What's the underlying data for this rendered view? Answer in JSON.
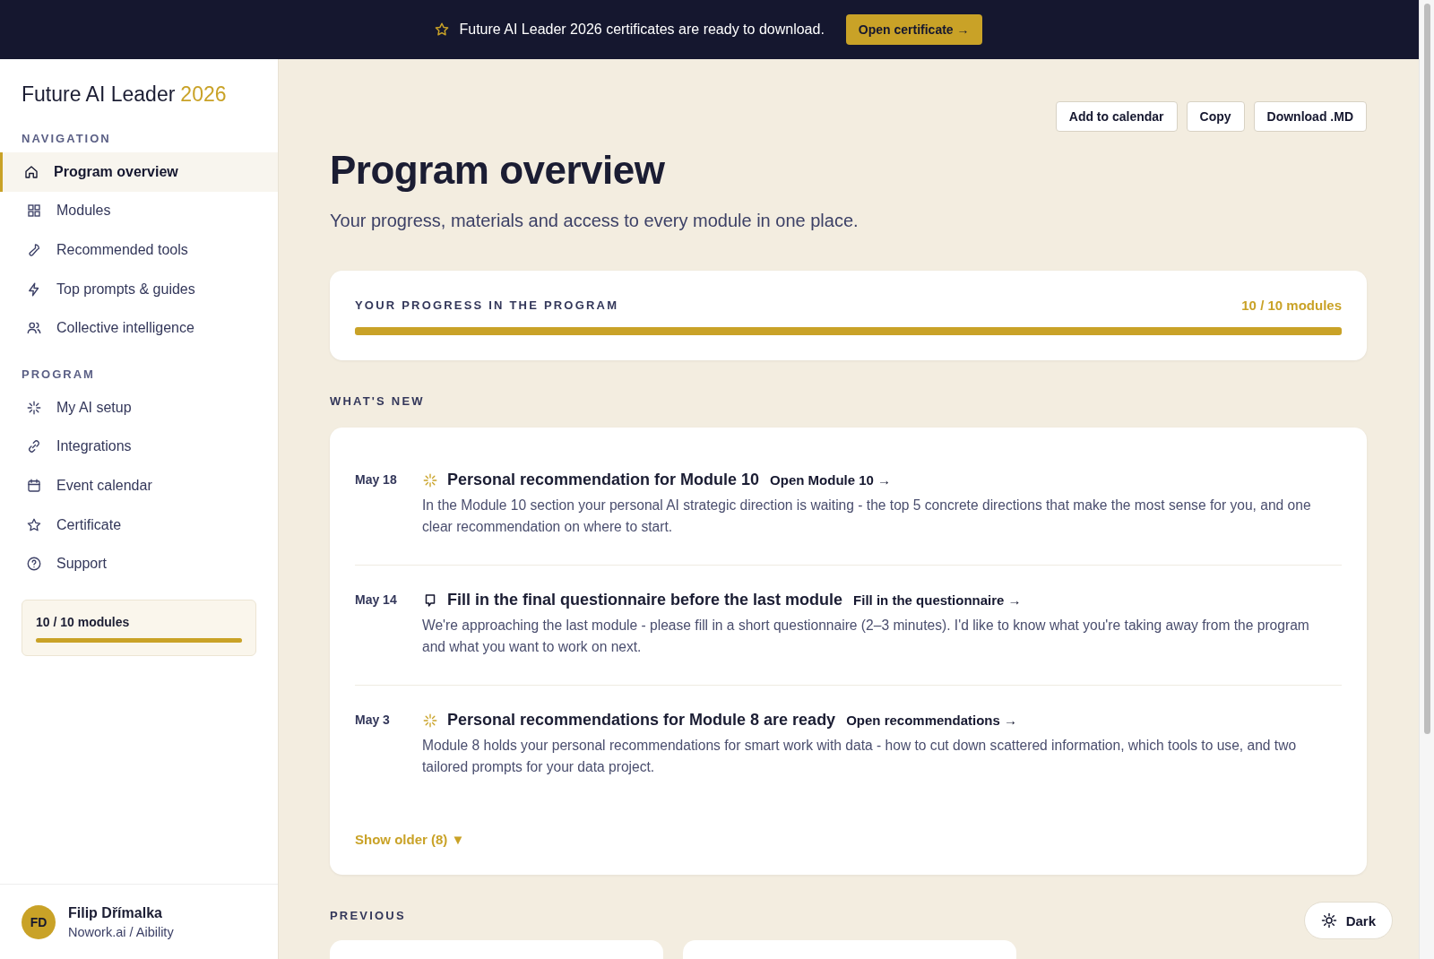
{
  "banner": {
    "text": "Future AI Leader 2026 certificates are ready to download.",
    "button": "Open certificate →"
  },
  "sidebar": {
    "brand": "Future AI Leader",
    "brand_year": "2026",
    "sections": [
      {
        "title": "NAVIGATION",
        "items": [
          {
            "label": "Program overview",
            "kind": "home",
            "selected": true
          },
          {
            "label": "Modules",
            "kind": "grid",
            "selected": false
          },
          {
            "label": "Recommended tools",
            "kind": "wrench",
            "selected": false
          },
          {
            "label": "Top prompts & guides",
            "kind": "bolt",
            "selected": false
          },
          {
            "label": "Collective intelligence",
            "kind": "users",
            "selected": false
          }
        ]
      },
      {
        "title": "PROGRAM",
        "items": [
          {
            "label": "My AI setup",
            "kind": "sparkle",
            "selected": false
          },
          {
            "label": "Integrations",
            "kind": "link",
            "selected": false
          },
          {
            "label": "Event calendar",
            "kind": "calendar",
            "selected": false
          },
          {
            "label": "Certificate",
            "kind": "star",
            "selected": false
          },
          {
            "label": "Support",
            "kind": "help",
            "selected": false
          }
        ]
      }
    ],
    "progress": {
      "label": "10 / 10 modules",
      "level": 1.0
    },
    "user": {
      "initials": "FD",
      "name": "Filip Dřímalka",
      "org": "Nowork.ai / Aibility"
    }
  },
  "toolbar": [
    "Add to calendar",
    "Copy",
    "Download .MD"
  ],
  "page": {
    "title": "Program overview",
    "subtitle": "Your progress, materials and access to every module in one place."
  },
  "progress_card": {
    "title": "YOUR PROGRESS IN THE PROGRAM",
    "count": "10 / 10 modules",
    "level": 1.0
  },
  "whats_new": {
    "title": "WHAT'S NEW",
    "items": [
      {
        "date": "May 18",
        "kind": "sparkle",
        "title": "Personal recommendation for Module 10",
        "link": "Open Module 10 →",
        "text": "In the Module 10 section your personal AI strategic direction is waiting - the top 5 concrete directions that make the most sense for you, and one clear recommendation on where to start."
      },
      {
        "date": "May 14",
        "kind": "note",
        "title": "Fill in the final questionnaire before the last module",
        "link": "Fill in the questionnaire →",
        "text": "We're approaching the last module - please fill in a short questionnaire (2–3 minutes). I'd like to know what you're taking away from the program and what you want to work on next."
      },
      {
        "date": "May 3",
        "kind": "sparkle",
        "title": "Personal recommendations for Module 8 are ready",
        "link": "Open recommendations →",
        "text": "Module 8 holds your personal recommendations for smart work with data - how to cut down scattered information, which tools to use, and two tailored prompts for your data project."
      }
    ],
    "show_older": "Show older (8) ▼"
  },
  "previous": {
    "title": "PREVIOUS"
  },
  "theme_button": "Dark"
}
